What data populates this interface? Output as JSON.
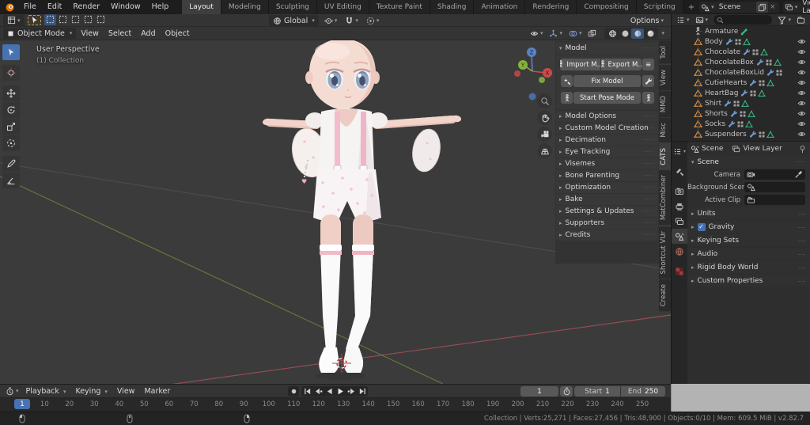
{
  "topbar": {
    "menus": [
      "File",
      "Edit",
      "Render",
      "Window",
      "Help"
    ],
    "workspace_tabs": [
      "Layout",
      "Modeling",
      "Sculpting",
      "UV Editing",
      "Texture Paint",
      "Shading",
      "Animation",
      "Rendering",
      "Compositing",
      "Scripting"
    ],
    "active_workspace": "Layout",
    "add_workspace_label": "+",
    "scene": {
      "value": "Scene"
    },
    "view_layer": {
      "value": "View Layer"
    }
  },
  "viewport": {
    "mode": "Object Mode",
    "menus": [
      "View",
      "Select",
      "Add",
      "Object"
    ],
    "options_label": "Options",
    "orientation": "Global",
    "overlay": {
      "perspective": "User Perspective",
      "collection": "(1) Collection"
    },
    "gizmo_axes": {
      "x": "X",
      "y": "Y",
      "z": "Z"
    },
    "tools": [
      "select-box",
      "cursor",
      "move",
      "rotate",
      "scale",
      "transform",
      "annotate",
      "measure"
    ],
    "active_tool": "select-box",
    "shading_modes": [
      "wireframe",
      "solid",
      "material-preview",
      "rendered"
    ],
    "active_shading": "material-preview"
  },
  "cats": {
    "tabs": [
      "Tool",
      "View",
      "MMD",
      "Misc",
      "CATS",
      "MatCombiner",
      "Shortcut VUr",
      "Create"
    ],
    "active_tab": "CATS",
    "model_panel": {
      "title": "Model",
      "import_label": "Import M...",
      "export_label": "Export M...",
      "fix_label": "Fix Model",
      "pose_label": "Start Pose Mode"
    },
    "sections": [
      "Model Options",
      "Custom Model Creation",
      "Decimation",
      "Eye Tracking",
      "Visemes",
      "Bone Parenting",
      "Optimization",
      "Bake",
      "Settings & Updates",
      "Supporters",
      "Credits"
    ]
  },
  "outliner": {
    "items": [
      {
        "name": "Armature",
        "type": "armature",
        "badges": [
          "bone-data"
        ],
        "eye": false
      },
      {
        "name": "Body",
        "type": "mesh",
        "badges": [
          "wrench",
          "armature-mod",
          "mesh-green"
        ],
        "eye": true
      },
      {
        "name": "Chocolate",
        "type": "mesh",
        "badges": [
          "wrench",
          "armature-mod",
          "mesh-green"
        ],
        "eye": true
      },
      {
        "name": "ChocolateBox",
        "type": "mesh",
        "badges": [
          "wrench",
          "armature-mod",
          "mesh-green"
        ],
        "eye": true
      },
      {
        "name": "ChocolateBoxLid",
        "type": "mesh",
        "badges": [
          "wrench",
          "armature-mod"
        ],
        "eye": true
      },
      {
        "name": "CutieHearts",
        "type": "mesh",
        "badges": [
          "wrench",
          "armature-mod",
          "mesh-green"
        ],
        "eye": true
      },
      {
        "name": "HeartBag",
        "type": "mesh",
        "badges": [
          "wrench",
          "armature-mod",
          "mesh-green"
        ],
        "eye": true
      },
      {
        "name": "Shirt",
        "type": "mesh",
        "badges": [
          "wrench",
          "armature-mod",
          "mesh-green"
        ],
        "eye": true
      },
      {
        "name": "Shorts",
        "type": "mesh",
        "badges": [
          "wrench",
          "armature-mod",
          "mesh-green"
        ],
        "eye": true
      },
      {
        "name": "Socks",
        "type": "mesh",
        "badges": [
          "wrench",
          "armature-mod",
          "mesh-green"
        ],
        "eye": true
      },
      {
        "name": "Suspenders",
        "type": "mesh",
        "badges": [
          "wrench",
          "armature-mod",
          "mesh-green"
        ],
        "eye": true
      }
    ]
  },
  "properties": {
    "tabs": [
      "tool",
      "render",
      "output",
      "view-layer",
      "scene",
      "world",
      "texture"
    ],
    "active_tab": "scene",
    "breadcrumb": {
      "scene": "Scene",
      "view_layer": "View Layer"
    },
    "scene_panel": {
      "title": "Scene",
      "fields": [
        {
          "label": "Camera",
          "icon": "camera-data",
          "extra": "eyedropper"
        },
        {
          "label": "Background Scene",
          "icon": "scene-data",
          "extra": ""
        },
        {
          "label": "Active Clip",
          "icon": "clip-data",
          "extra": ""
        }
      ]
    },
    "panels": [
      {
        "label": "Units",
        "checkbox": false
      },
      {
        "label": "Gravity",
        "checkbox": true
      },
      {
        "label": "Keying Sets",
        "checkbox": false
      },
      {
        "label": "Audio",
        "checkbox": false
      },
      {
        "label": "Rigid Body World",
        "checkbox": false
      },
      {
        "label": "Custom Properties",
        "checkbox": false
      }
    ]
  },
  "timeline": {
    "menus": [
      "Playback",
      "Keying",
      "View",
      "Marker"
    ],
    "current_frame": "1",
    "start_label": "Start",
    "start_value": "1",
    "end_label": "End",
    "end_value": "250",
    "ticks": [
      1,
      10,
      20,
      30,
      40,
      50,
      60,
      70,
      80,
      90,
      100,
      110,
      120,
      130,
      140,
      150,
      160,
      170,
      180,
      190,
      200,
      210,
      220,
      230,
      240,
      250
    ]
  },
  "statusbar": {
    "stats": "Collection | Verts:25,271 | Faces:27,456 | Tris:48,900 | Objects:0/10 | Mem: 609.5 MiB | v2.82.7"
  },
  "colors": {
    "accent": "#4772b3",
    "axis_x": "#cc4a4a",
    "axis_y": "#84b33c",
    "axis_z": "#5a83c4",
    "object_icon": "#e8953f",
    "data_icon": "#37bd82"
  }
}
